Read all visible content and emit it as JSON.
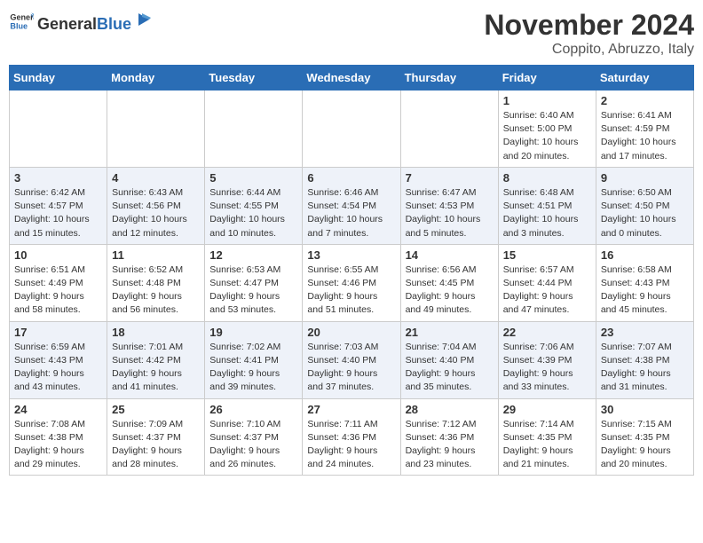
{
  "header": {
    "logo_general": "General",
    "logo_blue": "Blue",
    "title": "November 2024",
    "location": "Coppito, Abruzzo, Italy"
  },
  "weekdays": [
    "Sunday",
    "Monday",
    "Tuesday",
    "Wednesday",
    "Thursday",
    "Friday",
    "Saturday"
  ],
  "weeks": [
    [
      {
        "day": "",
        "info": ""
      },
      {
        "day": "",
        "info": ""
      },
      {
        "day": "",
        "info": ""
      },
      {
        "day": "",
        "info": ""
      },
      {
        "day": "",
        "info": ""
      },
      {
        "day": "1",
        "info": "Sunrise: 6:40 AM\nSunset: 5:00 PM\nDaylight: 10 hours and 20 minutes."
      },
      {
        "day": "2",
        "info": "Sunrise: 6:41 AM\nSunset: 4:59 PM\nDaylight: 10 hours and 17 minutes."
      }
    ],
    [
      {
        "day": "3",
        "info": "Sunrise: 6:42 AM\nSunset: 4:57 PM\nDaylight: 10 hours and 15 minutes."
      },
      {
        "day": "4",
        "info": "Sunrise: 6:43 AM\nSunset: 4:56 PM\nDaylight: 10 hours and 12 minutes."
      },
      {
        "day": "5",
        "info": "Sunrise: 6:44 AM\nSunset: 4:55 PM\nDaylight: 10 hours and 10 minutes."
      },
      {
        "day": "6",
        "info": "Sunrise: 6:46 AM\nSunset: 4:54 PM\nDaylight: 10 hours and 7 minutes."
      },
      {
        "day": "7",
        "info": "Sunrise: 6:47 AM\nSunset: 4:53 PM\nDaylight: 10 hours and 5 minutes."
      },
      {
        "day": "8",
        "info": "Sunrise: 6:48 AM\nSunset: 4:51 PM\nDaylight: 10 hours and 3 minutes."
      },
      {
        "day": "9",
        "info": "Sunrise: 6:50 AM\nSunset: 4:50 PM\nDaylight: 10 hours and 0 minutes."
      }
    ],
    [
      {
        "day": "10",
        "info": "Sunrise: 6:51 AM\nSunset: 4:49 PM\nDaylight: 9 hours and 58 minutes."
      },
      {
        "day": "11",
        "info": "Sunrise: 6:52 AM\nSunset: 4:48 PM\nDaylight: 9 hours and 56 minutes."
      },
      {
        "day": "12",
        "info": "Sunrise: 6:53 AM\nSunset: 4:47 PM\nDaylight: 9 hours and 53 minutes."
      },
      {
        "day": "13",
        "info": "Sunrise: 6:55 AM\nSunset: 4:46 PM\nDaylight: 9 hours and 51 minutes."
      },
      {
        "day": "14",
        "info": "Sunrise: 6:56 AM\nSunset: 4:45 PM\nDaylight: 9 hours and 49 minutes."
      },
      {
        "day": "15",
        "info": "Sunrise: 6:57 AM\nSunset: 4:44 PM\nDaylight: 9 hours and 47 minutes."
      },
      {
        "day": "16",
        "info": "Sunrise: 6:58 AM\nSunset: 4:43 PM\nDaylight: 9 hours and 45 minutes."
      }
    ],
    [
      {
        "day": "17",
        "info": "Sunrise: 6:59 AM\nSunset: 4:43 PM\nDaylight: 9 hours and 43 minutes."
      },
      {
        "day": "18",
        "info": "Sunrise: 7:01 AM\nSunset: 4:42 PM\nDaylight: 9 hours and 41 minutes."
      },
      {
        "day": "19",
        "info": "Sunrise: 7:02 AM\nSunset: 4:41 PM\nDaylight: 9 hours and 39 minutes."
      },
      {
        "day": "20",
        "info": "Sunrise: 7:03 AM\nSunset: 4:40 PM\nDaylight: 9 hours and 37 minutes."
      },
      {
        "day": "21",
        "info": "Sunrise: 7:04 AM\nSunset: 4:40 PM\nDaylight: 9 hours and 35 minutes."
      },
      {
        "day": "22",
        "info": "Sunrise: 7:06 AM\nSunset: 4:39 PM\nDaylight: 9 hours and 33 minutes."
      },
      {
        "day": "23",
        "info": "Sunrise: 7:07 AM\nSunset: 4:38 PM\nDaylight: 9 hours and 31 minutes."
      }
    ],
    [
      {
        "day": "24",
        "info": "Sunrise: 7:08 AM\nSunset: 4:38 PM\nDaylight: 9 hours and 29 minutes."
      },
      {
        "day": "25",
        "info": "Sunrise: 7:09 AM\nSunset: 4:37 PM\nDaylight: 9 hours and 28 minutes."
      },
      {
        "day": "26",
        "info": "Sunrise: 7:10 AM\nSunset: 4:37 PM\nDaylight: 9 hours and 26 minutes."
      },
      {
        "day": "27",
        "info": "Sunrise: 7:11 AM\nSunset: 4:36 PM\nDaylight: 9 hours and 24 minutes."
      },
      {
        "day": "28",
        "info": "Sunrise: 7:12 AM\nSunset: 4:36 PM\nDaylight: 9 hours and 23 minutes."
      },
      {
        "day": "29",
        "info": "Sunrise: 7:14 AM\nSunset: 4:35 PM\nDaylight: 9 hours and 21 minutes."
      },
      {
        "day": "30",
        "info": "Sunrise: 7:15 AM\nSunset: 4:35 PM\nDaylight: 9 hours and 20 minutes."
      }
    ]
  ]
}
